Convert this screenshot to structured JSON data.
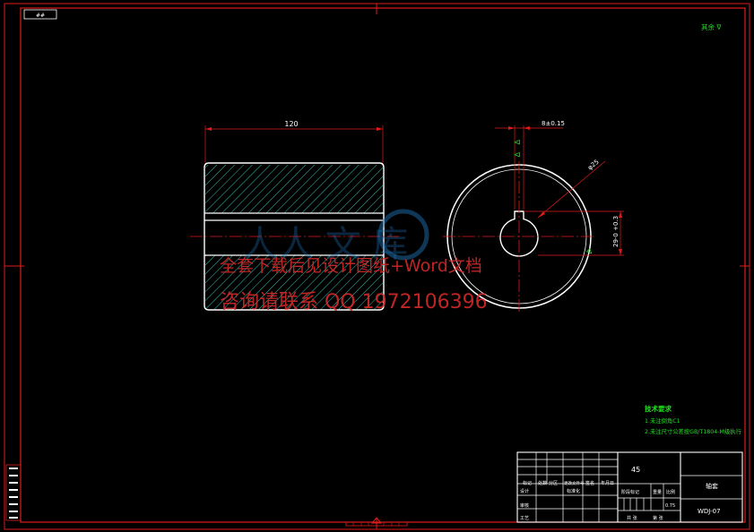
{
  "drawing": {
    "corner_label": "##",
    "top_right_symbol": "其余 ∇",
    "front_view": {
      "length_dim": "120"
    },
    "side_view": {
      "keyway_width_dim": "8±0.15",
      "keyway_depth_dim": "29-0 +0.3",
      "diameter_dim": "φ25",
      "roughness_symbols": [
        "∇",
        "∇",
        "∇"
      ]
    },
    "tech_req": {
      "title": "技术要求",
      "lines": [
        "1.未注倒角C1",
        "2.未注尺寸公差按GB/T1804-M级执行"
      ]
    },
    "title_block": {
      "material": "45",
      "part_name": "轴套",
      "drawing_no": "WDJ-07",
      "scale": "1:1",
      "weight": "0.75",
      "headers": [
        "标记",
        "处数",
        "分区",
        "更改文件号",
        "签名",
        "年月日"
      ],
      "roles": [
        "设计",
        "审核",
        "工艺"
      ],
      "std": "标准化",
      "stage_labels": [
        "阶段标记",
        "重量",
        "比例"
      ],
      "sheet_labels": [
        "共 张",
        "第 张"
      ]
    },
    "watermark": {
      "line1": "全套下载后见设计图纸+Word文档",
      "line2": "咨询请联系 QQ 1972106396"
    },
    "colors": {
      "frame": "#e01a1a",
      "geometry": "#ffffff",
      "dimension": "#e01a1a",
      "annotation": "#22e022",
      "hatch": "#3ad6c8",
      "watermark": "#d42a2a"
    }
  }
}
